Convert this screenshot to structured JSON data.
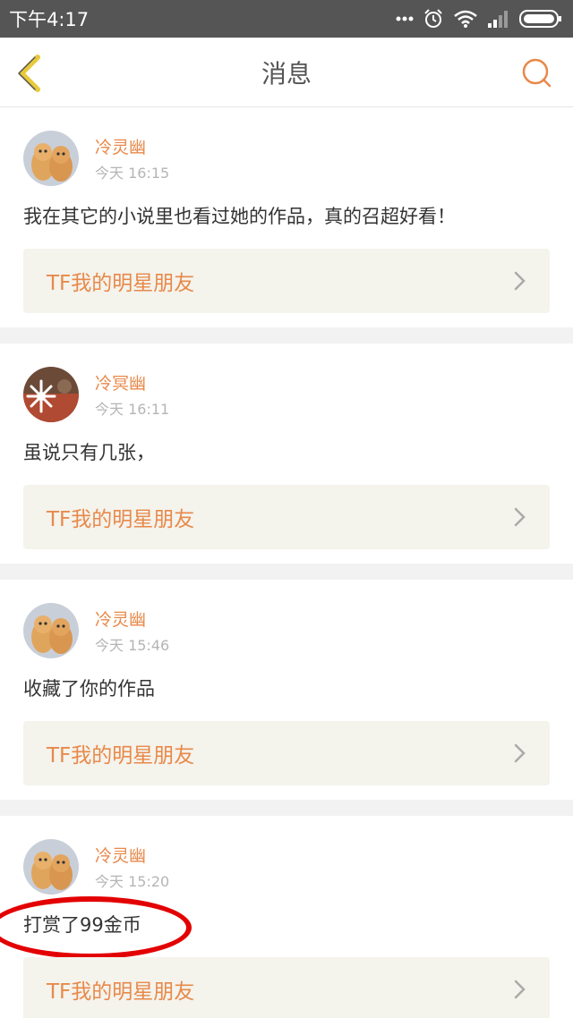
{
  "status_bar": {
    "time": "下午4:17",
    "icons": [
      "dots-icon",
      "alarm-icon",
      "wifi-icon",
      "signal-icon",
      "battery-icon"
    ]
  },
  "header": {
    "title": "消息",
    "back_icon": "chevron-left-icon",
    "search_icon": "search-icon"
  },
  "colors": {
    "accent": "#e8894a",
    "back_arrow": "#e8c93a",
    "highlight": "#e30000",
    "card_link_bg": "#f4f3ec"
  },
  "messages": [
    {
      "avatar": "cats-avatar",
      "username": "冷灵幽",
      "time": "今天 16:15",
      "text": "我在其它的小说里也看过她的作品，真的召超好看！",
      "work_title": "TF我的明星朋友"
    },
    {
      "avatar": "snowflake-avatar",
      "username": "冷冥幽",
      "time": "今天 16:11",
      "text": "虽说只有几张，",
      "work_title": "TF我的明星朋友"
    },
    {
      "avatar": "cats-avatar",
      "username": "冷灵幽",
      "time": "今天 15:46",
      "text": "收藏了你的作品",
      "work_title": "TF我的明星朋友"
    },
    {
      "avatar": "cats-avatar",
      "username": "冷灵幽",
      "time": "今天 15:20",
      "text": "打赏了99金币",
      "work_title": "TF我的明星朋友",
      "highlighted": true
    }
  ]
}
